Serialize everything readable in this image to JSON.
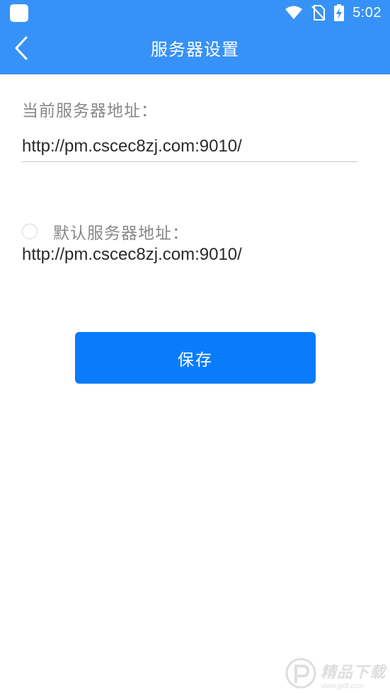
{
  "status_bar": {
    "time": "5:02",
    "icons": [
      "app-icon",
      "wifi-icon",
      "no-sim-icon",
      "battery-charging-icon"
    ]
  },
  "header": {
    "title": "服务器设置",
    "back_icon": "chevron-left-icon"
  },
  "current_server": {
    "label": "当前服务器地址：",
    "value": "http://pm.cscec8zj.com:9010/"
  },
  "default_server": {
    "label": "默认服务器地址：",
    "url": "http://pm.cscec8zj.com:9010/",
    "selected": false
  },
  "save_button": {
    "label": "保存"
  },
  "watermark": {
    "title": "精品下载",
    "url": "www.jpdl.com"
  },
  "colors": {
    "header_bg": "#3792f7",
    "button_bg": "#0a7cfb",
    "label_text": "#888888",
    "value_text": "#2a2a2a"
  }
}
